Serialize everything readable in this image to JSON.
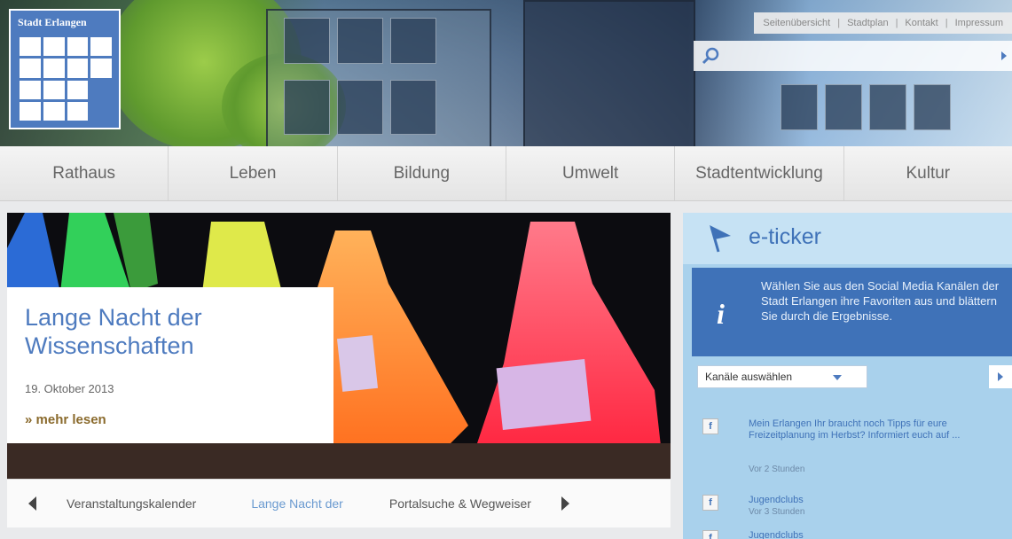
{
  "logo": {
    "text": "Stadt Erlangen"
  },
  "toplinks": [
    "Seitenübersicht",
    "Stadtplan",
    "Kontakt",
    "Impressum"
  ],
  "search": {
    "placeholder": ""
  },
  "nav": [
    "Rathaus",
    "Leben",
    "Bildung",
    "Umwelt",
    "Stadtentwicklung",
    "Kultur"
  ],
  "hero": {
    "title": "Lange Nacht der Wissenschaften",
    "date": "19. Oktober 2013",
    "more": "» mehr lesen"
  },
  "carousel": {
    "items": [
      "Veranstaltungskalender",
      "Lange Nacht der",
      "Portalsuche & Wegweiser"
    ],
    "active_index": 1
  },
  "ticker": {
    "title": "e-ticker",
    "info": "Wählen Sie aus den Social Media Kanälen der Stadt Erlangen ihre Favoriten aus und blättern Sie durch die Ergebnisse.",
    "select_label": "Kanäle auswählen",
    "items": [
      {
        "icon": "facebook-icon",
        "text": "Mein Erlangen Ihr braucht noch Tipps für eure Freizeitplanung im Herbst? Informiert euch auf ...",
        "time": "Vor 2 Stunden"
      },
      {
        "icon": "facebook-icon",
        "text": "Jugendclubs",
        "time": "Vor 3 Stunden"
      },
      {
        "icon": "facebook-icon",
        "text": "Jugendclubs",
        "time": ""
      }
    ]
  },
  "colors": {
    "brand_blue": "#4e7bbf",
    "ticker_bg": "#a9d1ec",
    "more_link": "#8a6a2c"
  }
}
